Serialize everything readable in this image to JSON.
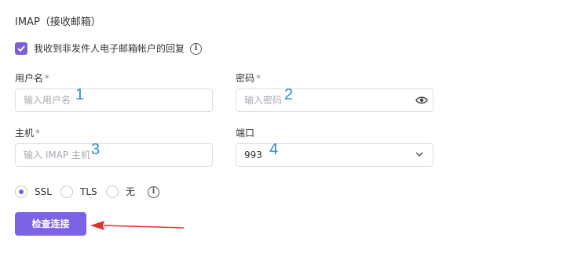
{
  "section": {
    "title": "IMAP（接收邮箱）"
  },
  "reply_checkbox": {
    "label": "我收到非发件人电子邮箱帐户的回复",
    "checked": true
  },
  "username": {
    "label": "用户名",
    "required_mark": "*",
    "placeholder": "输入用户名",
    "annotation": "1"
  },
  "password": {
    "label": "密码",
    "required_mark": "*",
    "placeholder": "输入密码",
    "annotation": "2"
  },
  "host": {
    "label": "主机",
    "required_mark": "*",
    "placeholder": "输入 IMAP 主机",
    "annotation": "3"
  },
  "port": {
    "label": "端口",
    "value": "993",
    "annotation": "4"
  },
  "security": {
    "options": [
      {
        "label": "SSL",
        "selected": true
      },
      {
        "label": "TLS",
        "selected": false
      },
      {
        "label": "无",
        "selected": false
      }
    ]
  },
  "check_button": {
    "label": "检查连接"
  },
  "colors": {
    "accent": "#7c62e4",
    "annotation": "#2a8fc9",
    "arrow": "#e0322d"
  },
  "icons": [
    "check-icon",
    "info-icon",
    "eye-icon",
    "chevron-down-icon",
    "red-arrow-annotation"
  ]
}
